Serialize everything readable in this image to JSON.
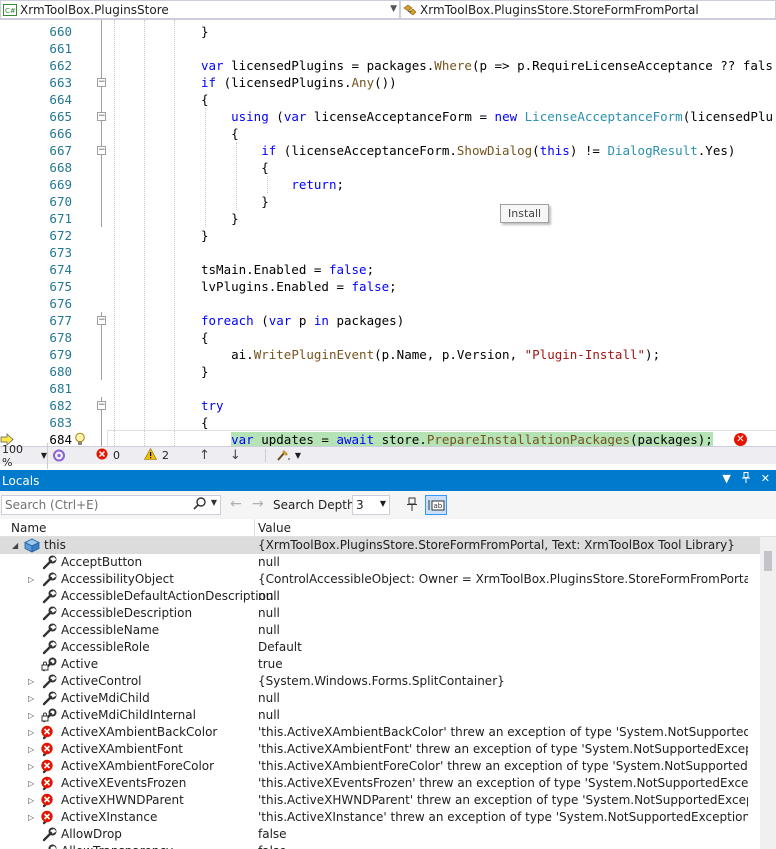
{
  "navbar": {
    "project": "XrmToolBox.PluginsStore",
    "member": "XrmToolBox.PluginsStore.StoreFormFromPortal"
  },
  "editor": {
    "lines": [
      {
        "n": "660",
        "code": "}"
      },
      {
        "n": "661",
        "code": ""
      },
      {
        "n": "662",
        "code": "var licensedPlugins = packages.Where(p => p.RequireLicenseAcceptance ?? fals"
      },
      {
        "n": "663",
        "code": "if (licensedPlugins.Any())"
      },
      {
        "n": "664",
        "code": "{"
      },
      {
        "n": "665",
        "code": "    using (var licenseAcceptanceForm = new LicenseAcceptanceForm(licensedPlu"
      },
      {
        "n": "666",
        "code": "    {"
      },
      {
        "n": "667",
        "code": "        if (licenseAcceptanceForm.ShowDialog(this) != DialogResult.Yes)"
      },
      {
        "n": "668",
        "code": "        {"
      },
      {
        "n": "669",
        "code": "            return;"
      },
      {
        "n": "670",
        "code": "        }"
      },
      {
        "n": "671",
        "code": "    }"
      },
      {
        "n": "672",
        "code": "}"
      },
      {
        "n": "673",
        "code": ""
      },
      {
        "n": "674",
        "code": "tsMain.Enabled = false;"
      },
      {
        "n": "675",
        "code": "lvPlugins.Enabled = false;"
      },
      {
        "n": "676",
        "code": ""
      },
      {
        "n": "677",
        "code": "foreach (var p in packages)"
      },
      {
        "n": "678",
        "code": "{"
      },
      {
        "n": "679",
        "code": "    ai.WritePluginEvent(p.Name, p.Version, \"Plugin-Install\");"
      },
      {
        "n": "680",
        "code": "}"
      },
      {
        "n": "681",
        "code": ""
      },
      {
        "n": "682",
        "code": "try"
      },
      {
        "n": "683",
        "code": "{"
      },
      {
        "n": "684",
        "code": "    var updates = await store.PrepareInstallationPackages(packages);"
      }
    ],
    "tooltip": "Install"
  },
  "statusbar": {
    "zoom": "100 %",
    "errors": "0",
    "warnings": "2"
  },
  "locals": {
    "title": "Locals",
    "search_placeholder": "Search (Ctrl+E)",
    "depth_label": "Search Depth:",
    "depth_value": "3",
    "col_name": "Name",
    "col_value": "Value",
    "rows": [
      {
        "name": "this",
        "value": "{XrmToolBox.PluginsStore.StoreFormFromPortal, Text: XrmToolBox Tool Library}",
        "icon": "object-icon",
        "exp": "open"
      },
      {
        "name": "AcceptButton",
        "value": "null",
        "icon": "wrench-icon",
        "exp": ""
      },
      {
        "name": "AccessibilityObject",
        "value": "{ControlAccessibleObject: Owner = XrmToolBox.PluginsStore.StoreFormFromPortal, Text: ...",
        "icon": "wrench-icon",
        "exp": "closed"
      },
      {
        "name": "AccessibleDefaultActionDescription",
        "value": "null",
        "icon": "wrench-icon",
        "exp": ""
      },
      {
        "name": "AccessibleDescription",
        "value": "null",
        "icon": "wrench-icon",
        "exp": ""
      },
      {
        "name": "AccessibleName",
        "value": "null",
        "icon": "wrench-icon",
        "exp": ""
      },
      {
        "name": "AccessibleRole",
        "value": "Default",
        "icon": "wrench-icon",
        "exp": ""
      },
      {
        "name": "Active",
        "value": "true",
        "icon": "wrench-lock-icon",
        "exp": ""
      },
      {
        "name": "ActiveControl",
        "value": "{System.Windows.Forms.SplitContainer}",
        "icon": "wrench-icon",
        "exp": "closed"
      },
      {
        "name": "ActiveMdiChild",
        "value": "null",
        "icon": "wrench-icon",
        "exp": "closed"
      },
      {
        "name": "ActiveMdiChildInternal",
        "value": "null",
        "icon": "wrench-lock-icon",
        "exp": "closed"
      },
      {
        "name": "ActiveXAmbientBackColor",
        "value": "'this.ActiveXAmbientBackColor' threw an exception of type 'System.NotSupportedExcepti...",
        "icon": "error-icon",
        "exp": "closed"
      },
      {
        "name": "ActiveXAmbientFont",
        "value": "'this.ActiveXAmbientFont' threw an exception of type 'System.NotSupportedException'",
        "icon": "error-icon",
        "exp": "closed"
      },
      {
        "name": "ActiveXAmbientForeColor",
        "value": "'this.ActiveXAmbientForeColor' threw an exception of type 'System.NotSupportedException'",
        "icon": "error-icon",
        "exp": "closed"
      },
      {
        "name": "ActiveXEventsFrozen",
        "value": "'this.ActiveXEventsFrozen' threw an exception of type 'System.NotSupportedException'",
        "icon": "error-icon",
        "exp": "closed"
      },
      {
        "name": "ActiveXHWNDParent",
        "value": "'this.ActiveXHWNDParent' threw an exception of type 'System.NotSupportedException'",
        "icon": "error-icon",
        "exp": "closed"
      },
      {
        "name": "ActiveXInstance",
        "value": "'this.ActiveXInstance' threw an exception of type 'System.NotSupportedException'",
        "icon": "error-icon",
        "exp": "closed"
      },
      {
        "name": "AllowDrop",
        "value": "false",
        "icon": "wrench-icon",
        "exp": ""
      },
      {
        "name": "AllowTransparency",
        "value": "false",
        "icon": "wrench-icon",
        "exp": ""
      }
    ]
  },
  "colors": {
    "accent": "#007acc",
    "keyword": "#0000ff",
    "type": "#2b91af",
    "method": "#74531f",
    "string": "#a31515",
    "highlight": "#b6e3b6",
    "error": "#e51400"
  }
}
